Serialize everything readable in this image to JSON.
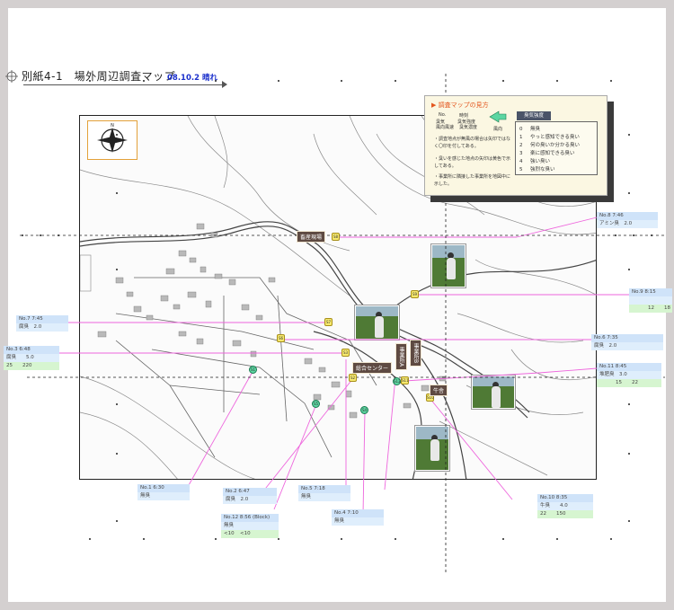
{
  "document": {
    "title": "別紙4-1　場外周辺調査マップ",
    "date": "08.10.2 晴れ"
  },
  "legend": {
    "title": "▶ 調査マップの見方",
    "example_station": "No.",
    "example_time": "時刻",
    "example_odor_type": "臭気",
    "example_odor_intensity": "臭気強度",
    "example_wind_dir": "風向",
    "example_wind_label": "風向風速",
    "example_speed_label": "臭気濃度",
    "wind_label": "風向",
    "notes": [
      "・調査地点が無風の場合は矢印ではなく〇印を付してある。",
      "・臭いを感じた地点の矢印は黄色で示してある。",
      "・事業所に隣接した事業所を地図中に示した。"
    ],
    "odor_header": "臭気強度",
    "odor_levels": [
      {
        "level": "0",
        "text": "無臭"
      },
      {
        "level": "1",
        "text": "やっと感知できる臭い"
      },
      {
        "level": "2",
        "text": "何の臭いか分かる臭い"
      },
      {
        "level": "3",
        "text": "楽に感知できる臭い"
      },
      {
        "level": "4",
        "text": "強い臭い"
      },
      {
        "level": "5",
        "text": "強烈な臭い"
      }
    ]
  },
  "places": [
    {
      "id": "chikusan",
      "label": "畜産現場"
    },
    {
      "id": "sogo",
      "label": "総合センター"
    },
    {
      "id": "v1",
      "label": "事業所A"
    },
    {
      "id": "v2",
      "label": "事業所B"
    },
    {
      "id": "ushi",
      "label": "牛舎"
    }
  ],
  "markers": [
    "S1",
    "S2",
    "S3",
    "S4",
    "S5",
    "S6",
    "S7",
    "S8",
    "S9",
    "S10",
    "S11",
    "S12"
  ],
  "stations": [
    {
      "id": "no8",
      "r1": "No.8  7:46",
      "r2": "アミン臭　2.0"
    },
    {
      "id": "no9",
      "r1": "No.9  8:15",
      "r2": "",
      "r3": [
        "",
        "12",
        "18"
      ]
    },
    {
      "id": "no7",
      "r1": "No.7  7:45",
      "r2": "腐臭　2.0"
    },
    {
      "id": "no6",
      "r1": "No.6  7:35",
      "r2": "腐臭　2.0"
    },
    {
      "id": "no3",
      "r1": "No.3  6:48",
      "r2": "腐臭　　5.0",
      "r3": [
        "25",
        "220"
      ]
    },
    {
      "id": "no11",
      "r1": "No.11  8:45",
      "r2": "堆肥臭　3.0",
      "r3": [
        "",
        "15",
        "22"
      ]
    },
    {
      "id": "no1",
      "r1": "No.1  6:30",
      "r2": "無臭"
    },
    {
      "id": "no2",
      "r1": "No.2  6:47",
      "r2": "腐臭　2.0"
    },
    {
      "id": "no5",
      "r1": "No.5  7:18",
      "r2": "無臭"
    },
    {
      "id": "no12",
      "r1": "No.12  8:56 (Block)",
      "r2": "無臭",
      "r3": [
        "<10",
        "<10"
      ]
    },
    {
      "id": "no4",
      "r1": "No.4  7:10",
      "r2": "無臭"
    },
    {
      "id": "no10",
      "r1": "No.10  8:35",
      "r2": "牛臭　　4.0",
      "r3": [
        "22",
        "150"
      ]
    }
  ],
  "colors": {
    "leader_line": "#ee66dd",
    "marker_yellow": "#f7e96e",
    "marker_green": "#5cd6a2",
    "label_bg": "#5e4a42",
    "station_blue": "#cfe3f9",
    "station_green": "#d6f5d0",
    "legend_bg": "#fbf7e2",
    "title_date": "#1a2fcc"
  }
}
